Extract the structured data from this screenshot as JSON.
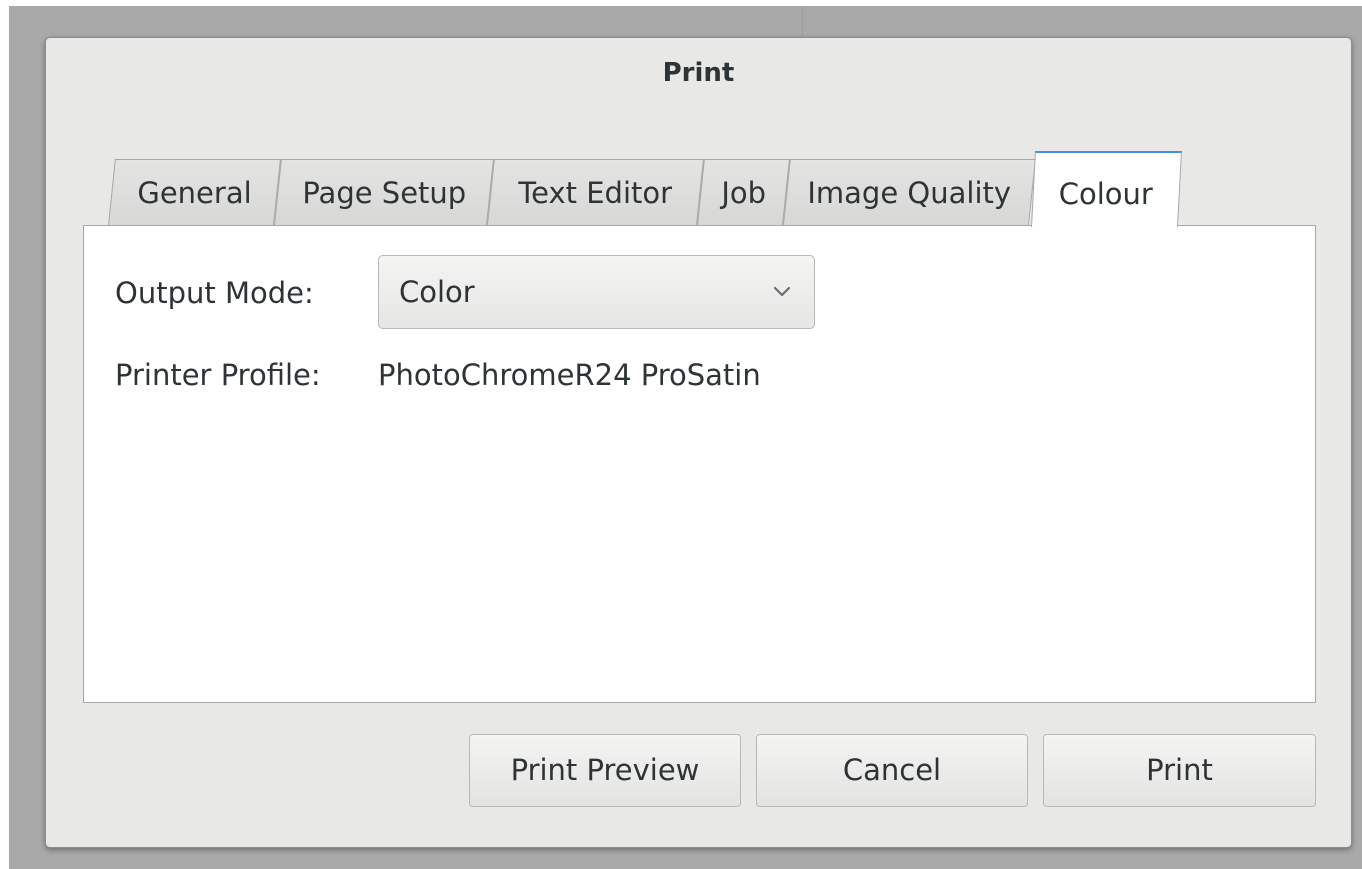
{
  "dialog": {
    "title": "Print"
  },
  "tabs": [
    {
      "label": "General"
    },
    {
      "label": "Page Setup"
    },
    {
      "label": "Text Editor"
    },
    {
      "label": "Job"
    },
    {
      "label": "Image Quality"
    },
    {
      "label": "Colour"
    }
  ],
  "active_tab": "Colour",
  "colour": {
    "output_mode_label": "Output Mode:",
    "output_mode_value": "Color",
    "printer_profile_label": "Printer Profile:",
    "printer_profile_value": "PhotoChromeR24 ProSatin"
  },
  "buttons": {
    "preview": "Print Preview",
    "cancel": "Cancel",
    "print": "Print"
  },
  "icons": {
    "combo_arrow": "chevron-down-icon"
  },
  "colors": {
    "accent": "#4a90d9",
    "backdrop": "#a9a9a9",
    "dialog_bg": "#e8e8e7",
    "text": "#2e3436"
  }
}
